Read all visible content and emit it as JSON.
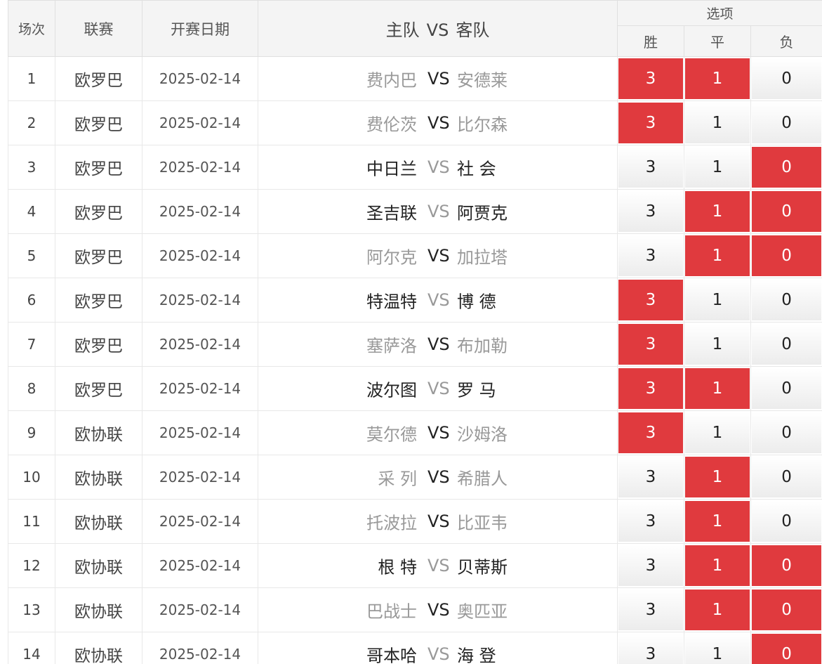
{
  "header": {
    "round": "场次",
    "league": "联赛",
    "date": "开赛日期",
    "home": "主队",
    "vs": "VS",
    "away": "客队",
    "options": "选项",
    "win": "胜",
    "draw": "平",
    "lose": "负"
  },
  "colors": {
    "selected": "#e03a3e",
    "header_bg": "#f4f4f4",
    "dim_text": "#999999"
  },
  "rows": [
    {
      "index": "1",
      "league": "欧罗巴",
      "date": "2025-02-14",
      "home": "费内巴",
      "vs": "VS",
      "away": "安德莱",
      "win": "3",
      "draw": "1",
      "lose": "0",
      "selected": [
        "win",
        "draw"
      ],
      "style": "dim-teams"
    },
    {
      "index": "2",
      "league": "欧罗巴",
      "date": "2025-02-14",
      "home": "费伦茨",
      "vs": "VS",
      "away": "比尔森",
      "win": "3",
      "draw": "1",
      "lose": "0",
      "selected": [
        "win"
      ],
      "style": "dim-teams"
    },
    {
      "index": "3",
      "league": "欧罗巴",
      "date": "2025-02-14",
      "home": "中日兰",
      "vs": "VS",
      "away": "社 会",
      "win": "3",
      "draw": "1",
      "lose": "0",
      "selected": [
        "lose"
      ],
      "style": "dim-vs"
    },
    {
      "index": "4",
      "league": "欧罗巴",
      "date": "2025-02-14",
      "home": "圣吉联",
      "vs": "VS",
      "away": "阿贾克",
      "win": "3",
      "draw": "1",
      "lose": "0",
      "selected": [
        "draw",
        "lose"
      ],
      "style": "dim-vs"
    },
    {
      "index": "5",
      "league": "欧罗巴",
      "date": "2025-02-14",
      "home": "阿尔克",
      "vs": "VS",
      "away": "加拉塔",
      "win": "3",
      "draw": "1",
      "lose": "0",
      "selected": [
        "draw",
        "lose"
      ],
      "style": "dim-teams"
    },
    {
      "index": "6",
      "league": "欧罗巴",
      "date": "2025-02-14",
      "home": "特温特",
      "vs": "VS",
      "away": "博 德",
      "win": "3",
      "draw": "1",
      "lose": "0",
      "selected": [
        "win"
      ],
      "style": "dim-vs"
    },
    {
      "index": "7",
      "league": "欧罗巴",
      "date": "2025-02-14",
      "home": "塞萨洛",
      "vs": "VS",
      "away": "布加勒",
      "win": "3",
      "draw": "1",
      "lose": "0",
      "selected": [
        "win"
      ],
      "style": "dim-teams"
    },
    {
      "index": "8",
      "league": "欧罗巴",
      "date": "2025-02-14",
      "home": "波尔图",
      "vs": "VS",
      "away": "罗 马",
      "win": "3",
      "draw": "1",
      "lose": "0",
      "selected": [
        "win",
        "draw"
      ],
      "style": "dim-vs"
    },
    {
      "index": "9",
      "league": "欧协联",
      "date": "2025-02-14",
      "home": "莫尔德",
      "vs": "VS",
      "away": "沙姆洛",
      "win": "3",
      "draw": "1",
      "lose": "0",
      "selected": [
        "win"
      ],
      "style": "dim-teams"
    },
    {
      "index": "10",
      "league": "欧协联",
      "date": "2025-02-14",
      "home": "采 列",
      "vs": "VS",
      "away": "希腊人",
      "win": "3",
      "draw": "1",
      "lose": "0",
      "selected": [
        "draw"
      ],
      "style": "dim-teams"
    },
    {
      "index": "11",
      "league": "欧协联",
      "date": "2025-02-14",
      "home": "托波拉",
      "vs": "VS",
      "away": "比亚韦",
      "win": "3",
      "draw": "1",
      "lose": "0",
      "selected": [
        "draw"
      ],
      "style": "dim-teams"
    },
    {
      "index": "12",
      "league": "欧协联",
      "date": "2025-02-14",
      "home": "根 特",
      "vs": "VS",
      "away": "贝蒂斯",
      "win": "3",
      "draw": "1",
      "lose": "0",
      "selected": [
        "draw",
        "lose"
      ],
      "style": "dim-vs"
    },
    {
      "index": "13",
      "league": "欧协联",
      "date": "2025-02-14",
      "home": "巴战士",
      "vs": "VS",
      "away": "奥匹亚",
      "win": "3",
      "draw": "1",
      "lose": "0",
      "selected": [
        "draw",
        "lose"
      ],
      "style": "dim-teams"
    },
    {
      "index": "14",
      "league": "欧协联",
      "date": "2025-02-14",
      "home": "哥本哈",
      "vs": "VS",
      "away": "海 登",
      "win": "3",
      "draw": "1",
      "lose": "0",
      "selected": [
        "lose"
      ],
      "style": "dim-vs"
    }
  ]
}
